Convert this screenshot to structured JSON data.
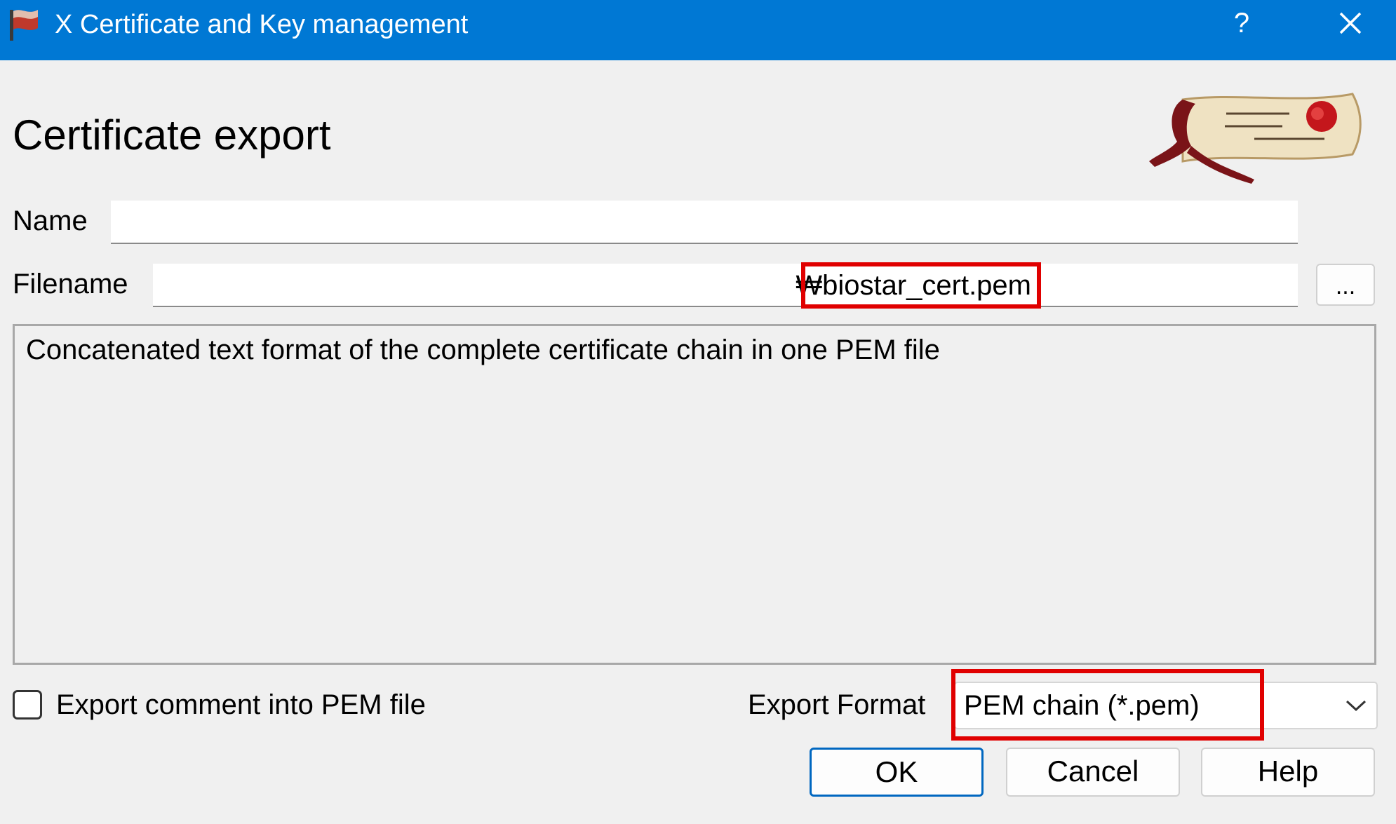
{
  "window": {
    "title": "X Certificate and Key management",
    "help_glyph": "?",
    "close_icon": "close-icon",
    "app_icon": "xca-flag-icon",
    "titlebar_color": "#0078d4"
  },
  "dialog": {
    "heading": "Certificate export",
    "logo": "xca-scroll-logo"
  },
  "form": {
    "name_label": "Name",
    "name_value": "",
    "filename_label": "Filename",
    "filename_value": "₩biostar_cert.pem",
    "browse_label": "...",
    "description": "Concatenated text format of the complete certificate chain in one PEM file",
    "export_comment_label": "Export comment into PEM file",
    "export_comment_checked": false,
    "export_format_label": "Export Format",
    "export_format_value": "PEM chain (*.pem)",
    "highlight_color": "#e00000"
  },
  "buttons": {
    "ok": "OK",
    "cancel": "Cancel",
    "help": "Help",
    "primary_border_color": "#0067c0"
  }
}
